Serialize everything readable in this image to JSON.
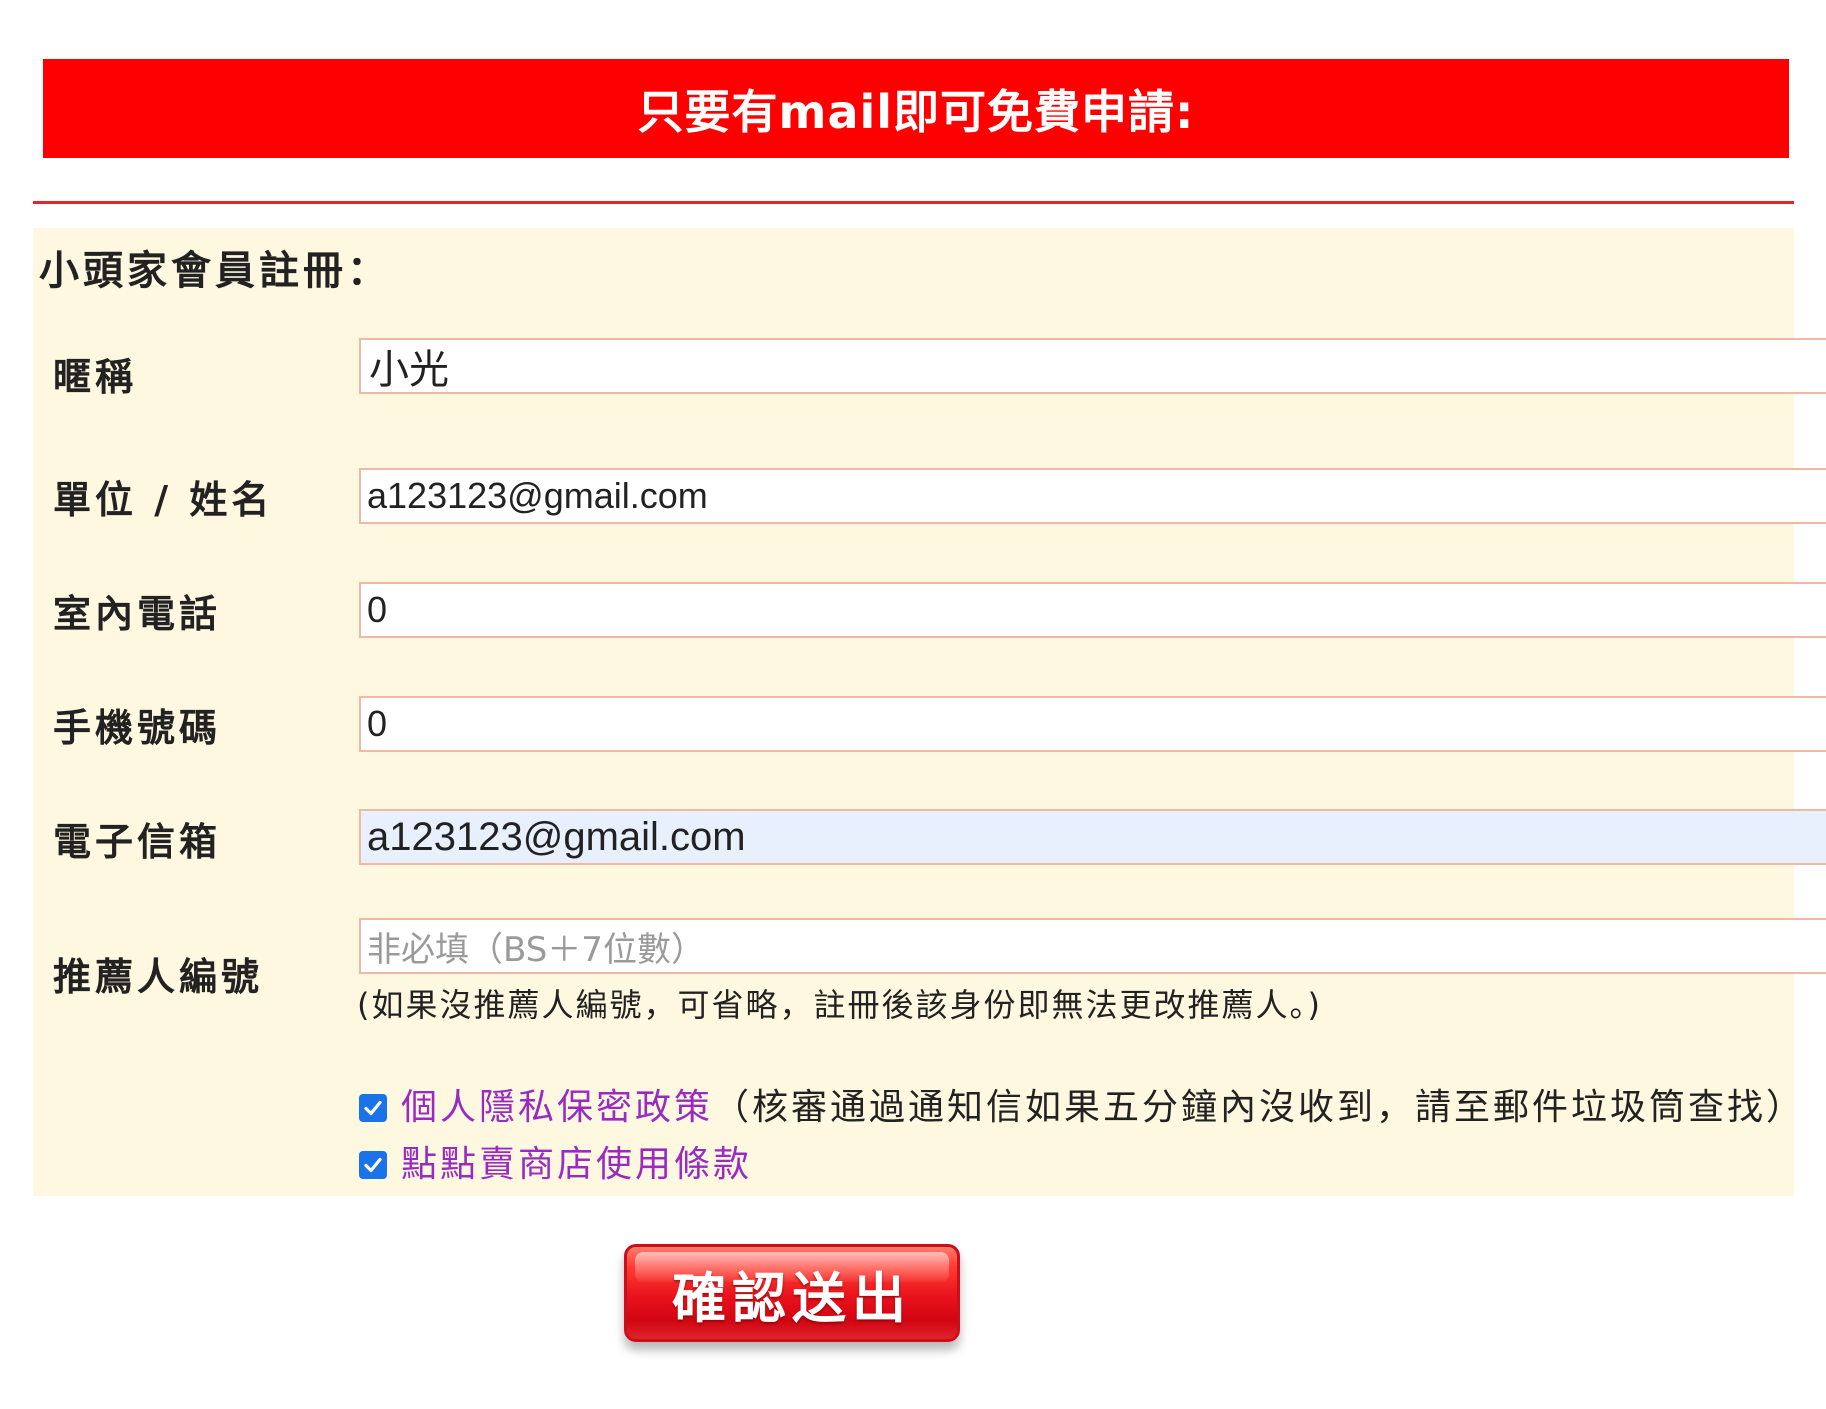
{
  "banner": {
    "text": "只要有mail即可免費申請:"
  },
  "form": {
    "title": "小頭家會員註冊：",
    "fields": [
      {
        "label": "暱稱",
        "value": "小光"
      },
      {
        "label": "單位 / 姓名",
        "value": "a123123@gmail.com"
      },
      {
        "label": "室內電話",
        "value": "0"
      },
      {
        "label": "手機號碼",
        "value": "0"
      },
      {
        "label": "電子信箱",
        "value": "a123123@gmail.com"
      },
      {
        "label": "推薦人編號",
        "value": "",
        "placeholder": "非必填（BS＋7位數）"
      }
    ],
    "referrer_hint": "(如果沒推薦人編號，可省略，註冊後該身份即無法更改推薦人。)",
    "agreements": [
      {
        "link": "個人隱私保密政策",
        "note": "（核審通過通知信如果五分鐘內沒收到，請至郵件垃圾筒查找）",
        "checked": true
      },
      {
        "link": "點點賣商店使用條款",
        "note": "",
        "checked": true
      }
    ]
  },
  "submit": {
    "label": "確認送出"
  },
  "colors": {
    "banner_bg": "#fe0000",
    "panel_bg": "#fff8e0",
    "input_border": "#f3b8a4",
    "autofill_bg": "#e8f0fe",
    "link": "#9a2bc1",
    "checkbox": "#1a73e8"
  },
  "icons": {
    "checkbox": "checkmark-icon"
  }
}
